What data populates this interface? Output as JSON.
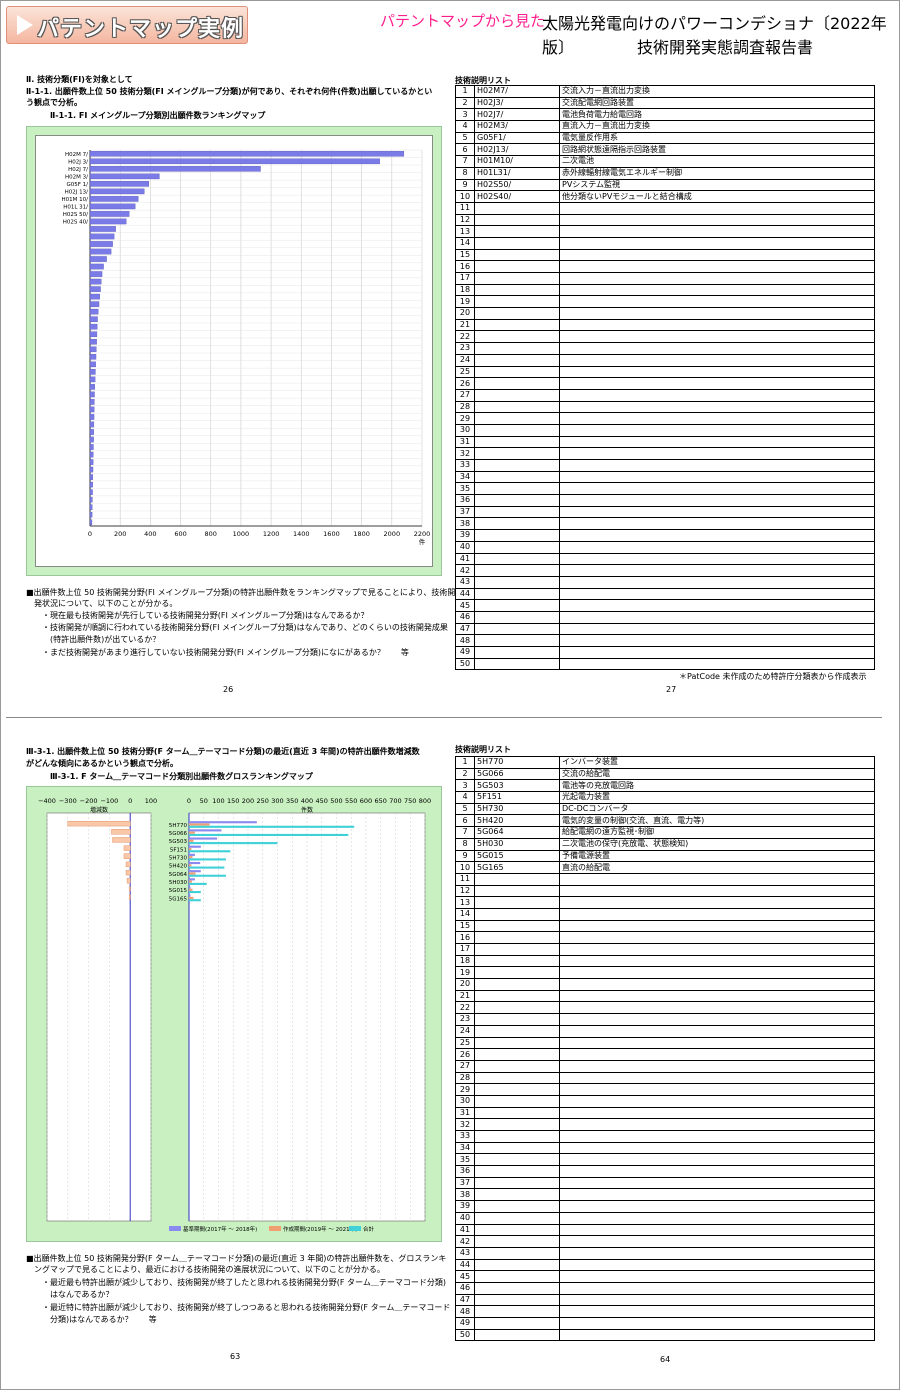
{
  "header": {
    "tab_title": "パテントマップ実例",
    "pink": "パテントマップから見た",
    "right1": "太陽光発電向けのパワーコンデショナ〔2022年版〕",
    "right2": "技術開発実態調査報告書"
  },
  "p26": {
    "h1": "Ⅱ. 技術分類(FI)を対象として",
    "h2a": "Ⅱ-1-1. 出願件数上位 50 技術分類(FI メイングループ分類)が何であり、それぞれ何件(件数)出願しているかとい",
    "h2b": "う観点で分析。",
    "caption": "Ⅱ-1-1. FI メイングループ分類別出願件数ランキングマップ",
    "para": [
      "■出願件数上位 50 技術開発分野(FI メイングループ分類)の特許出願件数をランキングマップで見ることにより、技術開",
      "　発状況について、以下のことが分かる。",
      "　・現在最も技術開発が先行している技術開発分野(FI メイングループ分類)はなんであるか？",
      "　・技術開発が順調に行われている技術開発分野(FI メイングループ分類)はなんであり、どのくらいの技術開発成果",
      "　　(特許出願件数)が出ているか？",
      "　・まだ技術開発があまり進行していない技術開発分野(FI メイングループ分類)になにがあるか？　　等"
    ],
    "page": "26"
  },
  "p27": {
    "title": "技術説明リスト",
    "page": "27",
    "note": "＊PatCode 未作成のため特許庁分類表から作成表示"
  },
  "p63": {
    "h1a": "Ⅲ-3-1. 出願件数上位 50 技術分野(F ターム＿テーマコード分類)の最近(直近 3 年間)の特許出願件数増減数",
    "h1b": "がどんな傾向にあるかという観点で分析。",
    "caption": "Ⅲ-3-1. F ターム＿テーマコード分類別出願件数グロスランキングマップ",
    "para": [
      "■出願件数上位 50 技術開発分野(F ターム＿テーマコード分類)の最近(直近 3 年間)の特許出願件数を、グロスランキ",
      "　ングマップで見ることにより、最近における技術開発の進展状況について、以下のことが分かる。",
      "　・最近最も特許出願が減少しており、技術開発が終了したと思われる技術開発分野(F ターム＿テーマコード分類)",
      "　　はなんであるか？",
      "　・最近特に特許出願が減少しており、技術開発が終了しつつあると思われる技術開発分野(F ターム＿テーマコード",
      "　　分類)はなんであるか？　　等"
    ],
    "page": "63"
  },
  "p64": {
    "title": "技術説明リスト",
    "page": "64"
  },
  "chart_data": [
    {
      "type": "bar",
      "title": "",
      "categories": [
        "H02M 7/",
        "H02J 3/",
        "H02J 7/",
        "H02M 3/",
        "G05F 1/",
        "H02J 13/",
        "H01M 10/",
        "H01L 31/",
        "H02S 50/",
        "H02S 40/"
      ],
      "values": [
        2080,
        1920,
        1130,
        460,
        390,
        360,
        320,
        300,
        260,
        240,
        170,
        160,
        150,
        140,
        110,
        90,
        80,
        75,
        70,
        65,
        60,
        55,
        50,
        48,
        46,
        44,
        42,
        40,
        38,
        36,
        34,
        32,
        30,
        29,
        28,
        27,
        26,
        25,
        24,
        23,
        22,
        21,
        20,
        19,
        18,
        17,
        16,
        15,
        14,
        13
      ],
      "xticks": [
        "0",
        "200",
        "400",
        "600",
        "800",
        "1000",
        "1200",
        "1400",
        "1600",
        "1800",
        "2000",
        "2200"
      ],
      "xlim": [
        0,
        2200
      ],
      "xunit": "件",
      "grid": true
    },
    {
      "type": "bar",
      "title": "",
      "legend": [
        "基準期間(2017年 ～ 2018年)",
        "作成期間(2019年 ～ 2021年)",
        "合計"
      ],
      "legend_position": "bottom",
      "left_label": "増減数",
      "right_label": "件数",
      "left_ticks": [
        "−400",
        "−300",
        "−200",
        "−100",
        "0",
        "100"
      ],
      "left_xlim": [
        -400,
        100
      ],
      "right_ticks": [
        "0",
        "50",
        "100",
        "150",
        "200",
        "250",
        "300",
        "350",
        "400",
        "450",
        "500",
        "550",
        "600",
        "650",
        "700",
        "750",
        "800"
      ],
      "right_xlim": [
        0,
        800
      ],
      "categories": [
        "5H770",
        "5G066",
        "5G503",
        "5F151",
        "5H730",
        "5H420",
        "5G064",
        "5H030",
        "5G015",
        "5G165"
      ],
      "series": [
        {
          "name": "基準期間(2017年 ～ 2018年)",
          "color": "#8a8af0",
          "values": [
            230,
            110,
            95,
            40,
            20,
            38,
            40,
            20,
            5,
            5
          ]
        },
        {
          "name": "作成期間(2019年 ～ 2021年)",
          "color": "#f0a070",
          "values": [
            70,
            20,
            15,
            8,
            12,
            8,
            22,
            10,
            12,
            15
          ]
        },
        {
          "name": "合計",
          "color": "#40d0d8",
          "values": [
            560,
            540,
            300,
            140,
            125,
            120,
            125,
            60,
            40,
            40
          ]
        }
      ],
      "diff": [
        -300,
        -90,
        -85,
        -30,
        -30,
        -20,
        -20,
        -15,
        -5,
        -5
      ]
    }
  ],
  "list1": [
    [
      "H02M7/",
      "交流入力－直流出力変換"
    ],
    [
      "H02J3/",
      "交流配電網回路装置"
    ],
    [
      "H02J7/",
      "電池負荷電力給電回路"
    ],
    [
      "H02M3/",
      "直流入力－直流出力変換"
    ],
    [
      "G05F1/",
      "電気量反作用系"
    ],
    [
      "H02J13/",
      "回路網状態遠隔指示回路装置"
    ],
    [
      "H01M10/",
      "二次電池"
    ],
    [
      "H01L31/",
      "赤外線輻射線電気エネルギー制御"
    ],
    [
      "H02S50/",
      "PVシステム監視"
    ],
    [
      "H02S40/",
      "他分類ないPVモジュールと結合構成"
    ]
  ],
  "list2": [
    [
      "5H770",
      "インバータ装置"
    ],
    [
      "5G066",
      "交流の給配電"
    ],
    [
      "5G503",
      "電池等の充放電回路"
    ],
    [
      "5F151",
      "光起電力装置"
    ],
    [
      "5H730",
      "DC-DCコンバータ"
    ],
    [
      "5H420",
      "電気的変量の制御(交流、直流、電力等)"
    ],
    [
      "5G064",
      "給配電網の遠方監視･制御"
    ],
    [
      "5H030",
      "二次電池の保守(充放電、状態検知)"
    ],
    [
      "5G015",
      "予備電源装置"
    ],
    [
      "5G165",
      "直流の給配電"
    ]
  ],
  "colors": {
    "tab_top": "#fbe4d8",
    "pink": "#ff1f8f",
    "chart_bg": "#c8f0c0",
    "bar": "#7b7be8"
  }
}
